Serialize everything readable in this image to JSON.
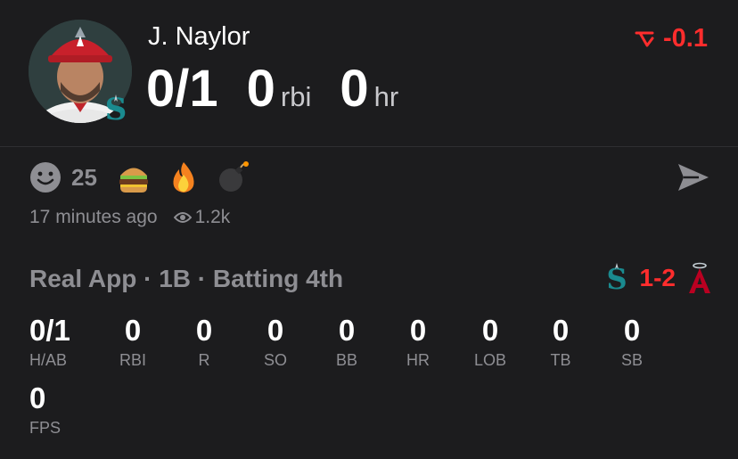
{
  "player": {
    "name": "J. Naylor",
    "hits_ab": "0/1",
    "rbi_value": "0",
    "rbi_unit": "rbi",
    "hr_value": "0",
    "hr_unit": "hr"
  },
  "delta": {
    "value": "-0.1",
    "icon": "trend-down-icon",
    "color": "#ff2d2d"
  },
  "reactions": {
    "count": "25",
    "items": [
      "smiley-icon",
      "burger-emoji",
      "fire-emoji",
      "bomb-emoji"
    ]
  },
  "post": {
    "time": "17 minutes ago",
    "views": "1.2k"
  },
  "game": {
    "line": "Real App · 1B · Batting 4th",
    "score": "1-2",
    "away_team_icon": "mariners-logo-icon",
    "home_team_icon": "angels-logo-icon"
  },
  "stats": [
    {
      "value": "0/1",
      "label": "H/AB"
    },
    {
      "value": "0",
      "label": "RBI"
    },
    {
      "value": "0",
      "label": "R"
    },
    {
      "value": "0",
      "label": "SO"
    },
    {
      "value": "0",
      "label": "BB"
    },
    {
      "value": "0",
      "label": "HR"
    },
    {
      "value": "0",
      "label": "LOB"
    },
    {
      "value": "0",
      "label": "TB"
    },
    {
      "value": "0",
      "label": "SB"
    },
    {
      "value": "0",
      "label": "FPS"
    }
  ]
}
